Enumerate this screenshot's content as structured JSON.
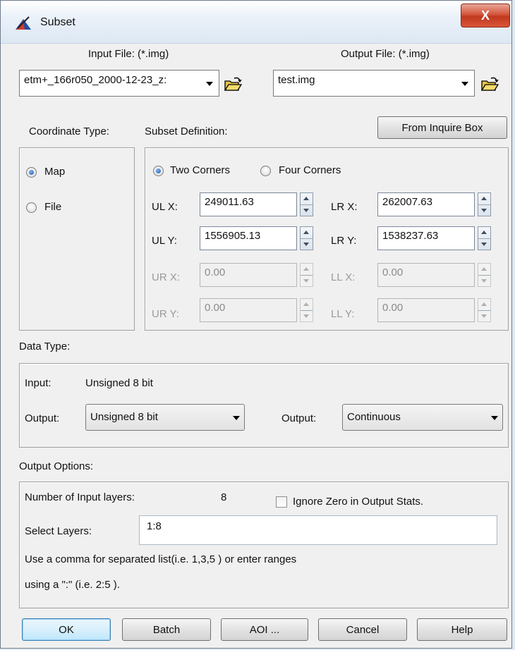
{
  "window": {
    "title": "Subset",
    "close_label": "X"
  },
  "input_file": {
    "label": "Input File: (*.img)",
    "value": "etm+_166r050_2000-12-23_z:"
  },
  "output_file": {
    "label": "Output File: (*.img)",
    "value": "test.img"
  },
  "coordinate_type": {
    "label": "Coordinate Type:",
    "options": [
      "Map",
      "File"
    ],
    "selected": "Map"
  },
  "subset_definition": {
    "label": "Subset Definition:",
    "from_inquire_label": "From Inquire Box",
    "corner_options": [
      "Two Corners",
      "Four Corners"
    ],
    "selected": "Two Corners",
    "ulx": {
      "label": "UL X:",
      "value": "249011.63"
    },
    "lrx": {
      "label": "LR X:",
      "value": "262007.63"
    },
    "uly": {
      "label": "UL Y:",
      "value": "1556905.13"
    },
    "lry": {
      "label": "LR Y:",
      "value": "1538237.63"
    },
    "urx": {
      "label": "UR X:",
      "value": "0.00"
    },
    "llx": {
      "label": "LL X:",
      "value": "0.00"
    },
    "ury": {
      "label": "UR Y:",
      "value": "0.00"
    },
    "lly": {
      "label": "LL Y:",
      "value": "0.00"
    }
  },
  "data_type": {
    "label": "Data Type:",
    "input_label": "Input:",
    "input_value": "Unsigned 8 bit",
    "output_label": "Output:",
    "output_value": "Unsigned 8 bit",
    "output2_label": "Output:",
    "output2_value": "Continuous"
  },
  "output_options": {
    "label": "Output Options:",
    "num_layers_label": "Number of Input layers:",
    "num_layers_value": "8",
    "ignore_zero_label": "Ignore Zero in Output Stats.",
    "ignore_zero_checked": false,
    "select_layers_label": "Select Layers:",
    "select_layers_value": "1:8",
    "help_line1": "Use a comma for separated list(i.e. 1,3,5 ) or enter ranges",
    "help_line2": "using a \":\" (i.e. 2:5 )."
  },
  "buttons": {
    "ok": "OK",
    "batch": "Batch",
    "aoi": "AOI ...",
    "cancel": "Cancel",
    "help": "Help"
  },
  "colors": {
    "accent": "#3c7fb1",
    "close": "#c0381e",
    "window_bg": "#f0f0f0"
  }
}
